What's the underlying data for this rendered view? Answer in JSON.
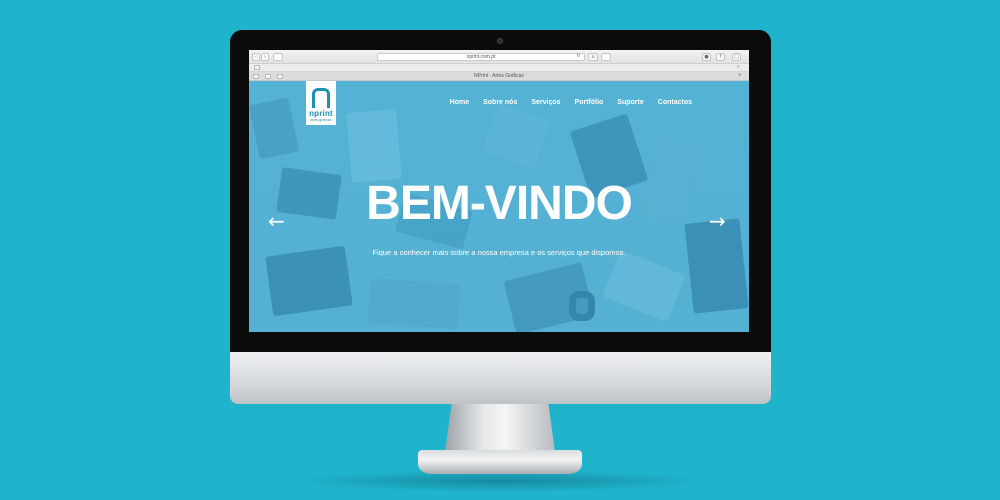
{
  "browser": {
    "address": "nprint.com.pt",
    "tab_title": "NPrint - Artes Gráficas",
    "icons": [
      "back-icon",
      "forward-icon",
      "sidebar-icon",
      "reload-icon",
      "home-icon",
      "print-icon",
      "download-icon",
      "share-icon",
      "tabs-icon",
      "overflow-icon"
    ]
  },
  "site": {
    "logo": {
      "word": "nprint",
      "tagline": "artes gráficas"
    },
    "nav": [
      "Home",
      "Sobre nós",
      "Serviços",
      "Portfólio",
      "Suporte",
      "Contactos"
    ],
    "hero": {
      "headline": "BEM-VINDO",
      "subtitle": "Fique a conhecer mais sobre a nossa empresa e os serviços que dispomos.",
      "prev_arrow": "←",
      "next_arrow": "→"
    }
  },
  "colors": {
    "background": "#20b4cc",
    "hero_tint": "#58b4d4",
    "logo_blue": "#1d90b3"
  }
}
